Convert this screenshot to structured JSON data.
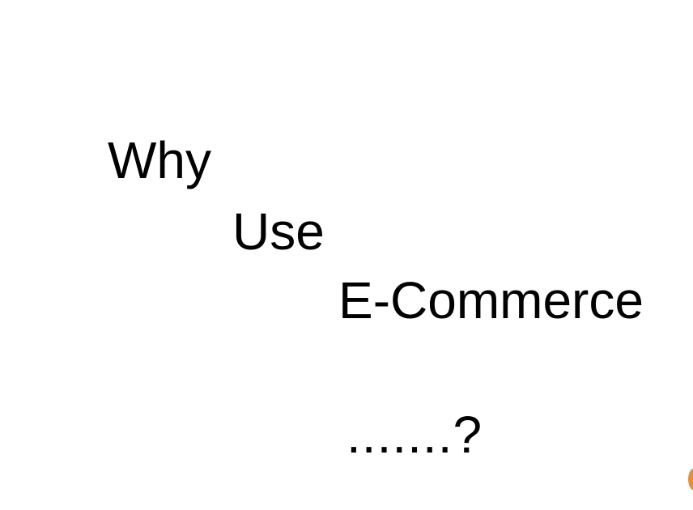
{
  "slide": {
    "line_1": "Why",
    "line_2": "Use",
    "line_3": "E-Commerce",
    "line_4": ".......?"
  },
  "colors": {
    "background": "#ffffff",
    "text": "#000000",
    "corner_accent": "#f28c28"
  }
}
